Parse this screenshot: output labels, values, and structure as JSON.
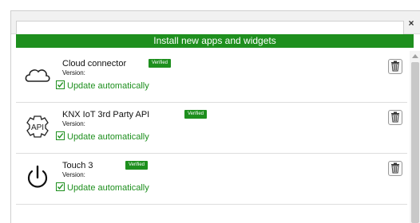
{
  "header": {
    "close_label": "×",
    "install_label": "Install new apps and widgets"
  },
  "items": [
    {
      "name": "Cloud connector",
      "version_label": "Version:",
      "badge": "Verified",
      "update_label": "Update automatically",
      "icon": "cloud-icon"
    },
    {
      "name": "KNX IoT 3rd Party API",
      "version_label": "Version:",
      "badge": "Verified",
      "update_label": "Update automatically",
      "icon": "api-gear-icon",
      "icon_text": "API"
    },
    {
      "name": "Touch 3",
      "version_label": "Version:",
      "badge": "Verified",
      "update_label": "Update automatically",
      "icon": "power-icon"
    }
  ],
  "colors": {
    "accent": "#1e8f1e",
    "border": "#cfcfcf"
  }
}
